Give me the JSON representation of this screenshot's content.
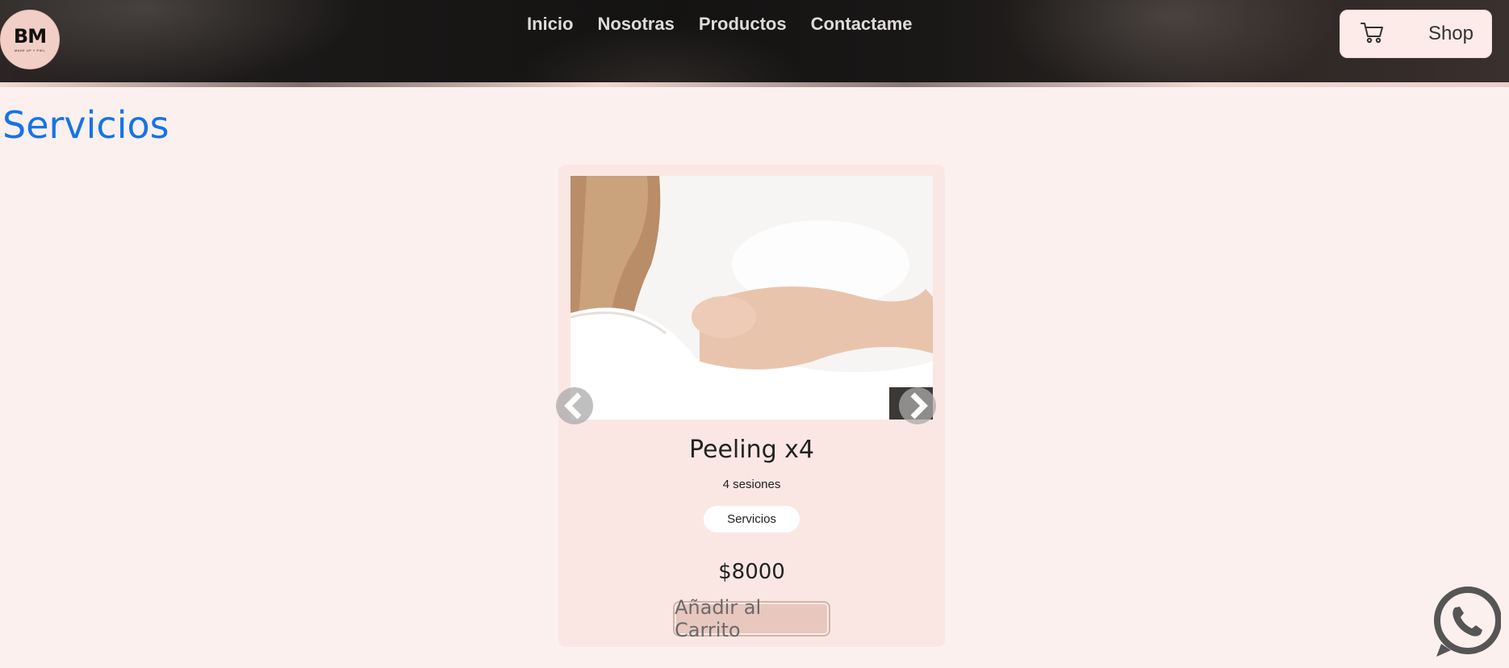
{
  "header": {
    "logo": {
      "mark": "BM",
      "subtitle": "MAKE UP Y PIEL"
    },
    "nav": [
      "Inicio",
      "Nosotras",
      "Productos",
      "Contactame"
    ],
    "shop": {
      "label": "Shop",
      "icon": "cart-icon"
    }
  },
  "main": {
    "title": "Servicios",
    "product": {
      "name": "Peeling x4",
      "description": "4 sesiones",
      "category": "Servicios",
      "price": "$8000",
      "add_to_cart_label": "Añadir al Carrito"
    }
  },
  "floating": {
    "whatsapp_icon": "whatsapp-icon"
  },
  "colors": {
    "page_bg": "#fcf0ee",
    "card_bg": "#fae7e3",
    "title_blue": "#1673e8",
    "button_bg": "#e8c7bf"
  }
}
